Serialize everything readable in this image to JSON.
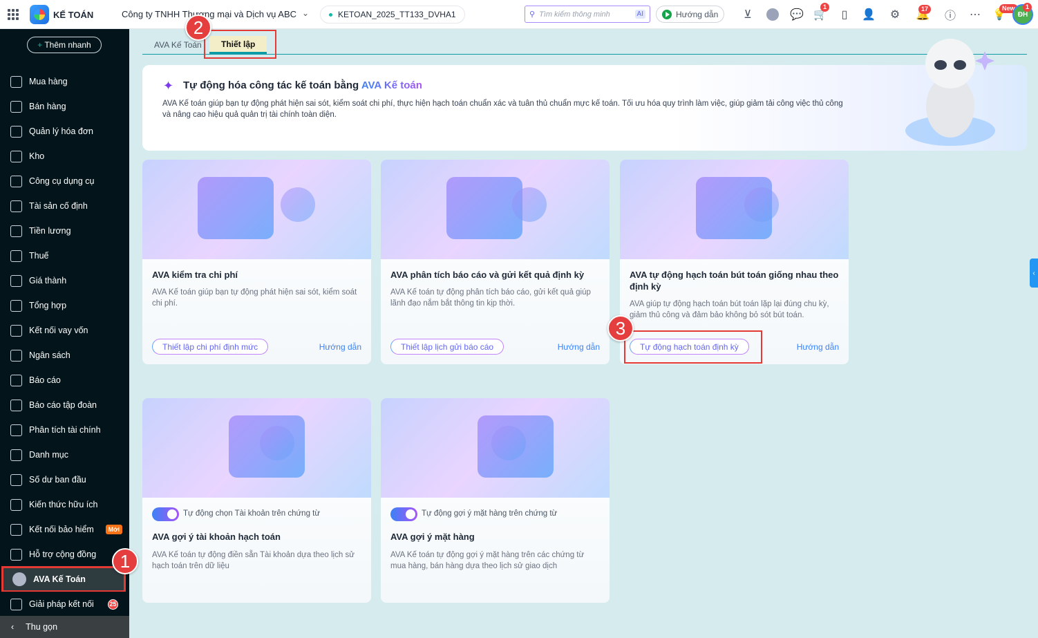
{
  "header": {
    "app_name": "KẾ TOÁN",
    "company": "Công ty TNHH Thương mại và Dịch vụ ABC",
    "database": "KETOAN_2025_TT133_DVHA1",
    "search_placeholder": "Tìm kiếm thông minh",
    "search_ai": "AI",
    "guide_label": "Hướng dẫn",
    "cart_badge": "1",
    "notification_badge": "17",
    "new_badge": "New",
    "avatar_badge": "1",
    "avatar_initials": "ĐH"
  },
  "sidebar": {
    "quick_add": "Thêm nhanh",
    "items": [
      {
        "label": "Mua hàng"
      },
      {
        "label": "Bán hàng"
      },
      {
        "label": "Quản lý hóa đơn"
      },
      {
        "label": "Kho"
      },
      {
        "label": "Công cụ dụng cụ"
      },
      {
        "label": "Tài sản cố định"
      },
      {
        "label": "Tiền lương"
      },
      {
        "label": "Thuế"
      },
      {
        "label": "Giá thành"
      },
      {
        "label": "Tổng hợp"
      },
      {
        "label": "Kết nối vay vốn"
      },
      {
        "label": "Ngân sách"
      },
      {
        "label": "Báo cáo"
      },
      {
        "label": "Báo cáo tập đoàn"
      },
      {
        "label": "Phân tích tài chính"
      },
      {
        "label": "Danh mục"
      },
      {
        "label": "Số dư ban đầu"
      },
      {
        "label": "Kiến thức hữu ích"
      },
      {
        "label": "Kết nối bảo hiểm",
        "tag": "Mới"
      },
      {
        "label": "Hỗ trợ cộng đồng"
      },
      {
        "label": "AVA Kế Toán",
        "active": true
      },
      {
        "label": "Giải pháp kết nối",
        "count": "25"
      }
    ],
    "collapse": "Thu gọn"
  },
  "tabs": [
    {
      "label": "AVA Kế Toán"
    },
    {
      "label": "Thiết lập",
      "active": true
    }
  ],
  "steps": [
    "1",
    "2",
    "3"
  ],
  "hero": {
    "title": "Tự động hóa công tác kế toán bằng ",
    "title_highlight": "AVA Kế toán",
    "description": "AVA Kế toán giúp bạn tự động phát hiện sai sót, kiểm soát chi phí, thực hiện hạch toán chuẩn xác và tuân thủ chuẩn mực kế toán. Tối ưu hóa quy trình làm việc, giúp giảm tải công việc thủ công và nâng cao hiệu quả quản trị tài chính toàn diện."
  },
  "cards": [
    {
      "title": "AVA kiểm tra chi phí",
      "description": "AVA Kế toán giúp bạn tự động phát hiện sai sót, kiểm soát chi phí.",
      "button": "Thiết lập chi phí định mức",
      "link": "Hướng dẫn"
    },
    {
      "title": "AVA phân tích báo cáo và gửi kết quả định kỳ",
      "description": "AVA Kế toán tự động phân tích báo cáo, gửi kết quả giúp lãnh đạo nắm bắt thông tin kịp thời.",
      "button": "Thiết lập lịch gửi báo cáo",
      "link": "Hướng dẫn"
    },
    {
      "title": "AVA tự động hạch toán bút toán giống nhau theo định kỳ",
      "description": "AVA giúp tự động hạch toán bút toán lặp lại đúng chu kỳ, giảm thủ công và đảm bảo không bỏ sót bút toán.",
      "button": "Tự động hạch toán định kỳ",
      "link": "Hướng dẫn"
    },
    {
      "toggle_label": "Tự động chọn Tài khoản trên chứng từ",
      "toggle_on": true,
      "title": "AVA gợi ý tài khoản hạch toán",
      "description": "AVA Kế toán tự động điền sẵn Tài khoản dựa theo lịch sử hạch toán trên dữ liệu"
    },
    {
      "toggle_label": "Tự động gợi ý mặt hàng trên chứng từ",
      "toggle_on": true,
      "title": "AVA gợi ý mặt hàng",
      "description": "AVA Kế toán tự động gợi ý mặt hàng trên các chứng từ mua hàng, bán hàng dựa theo lịch sử giao dịch"
    }
  ]
}
